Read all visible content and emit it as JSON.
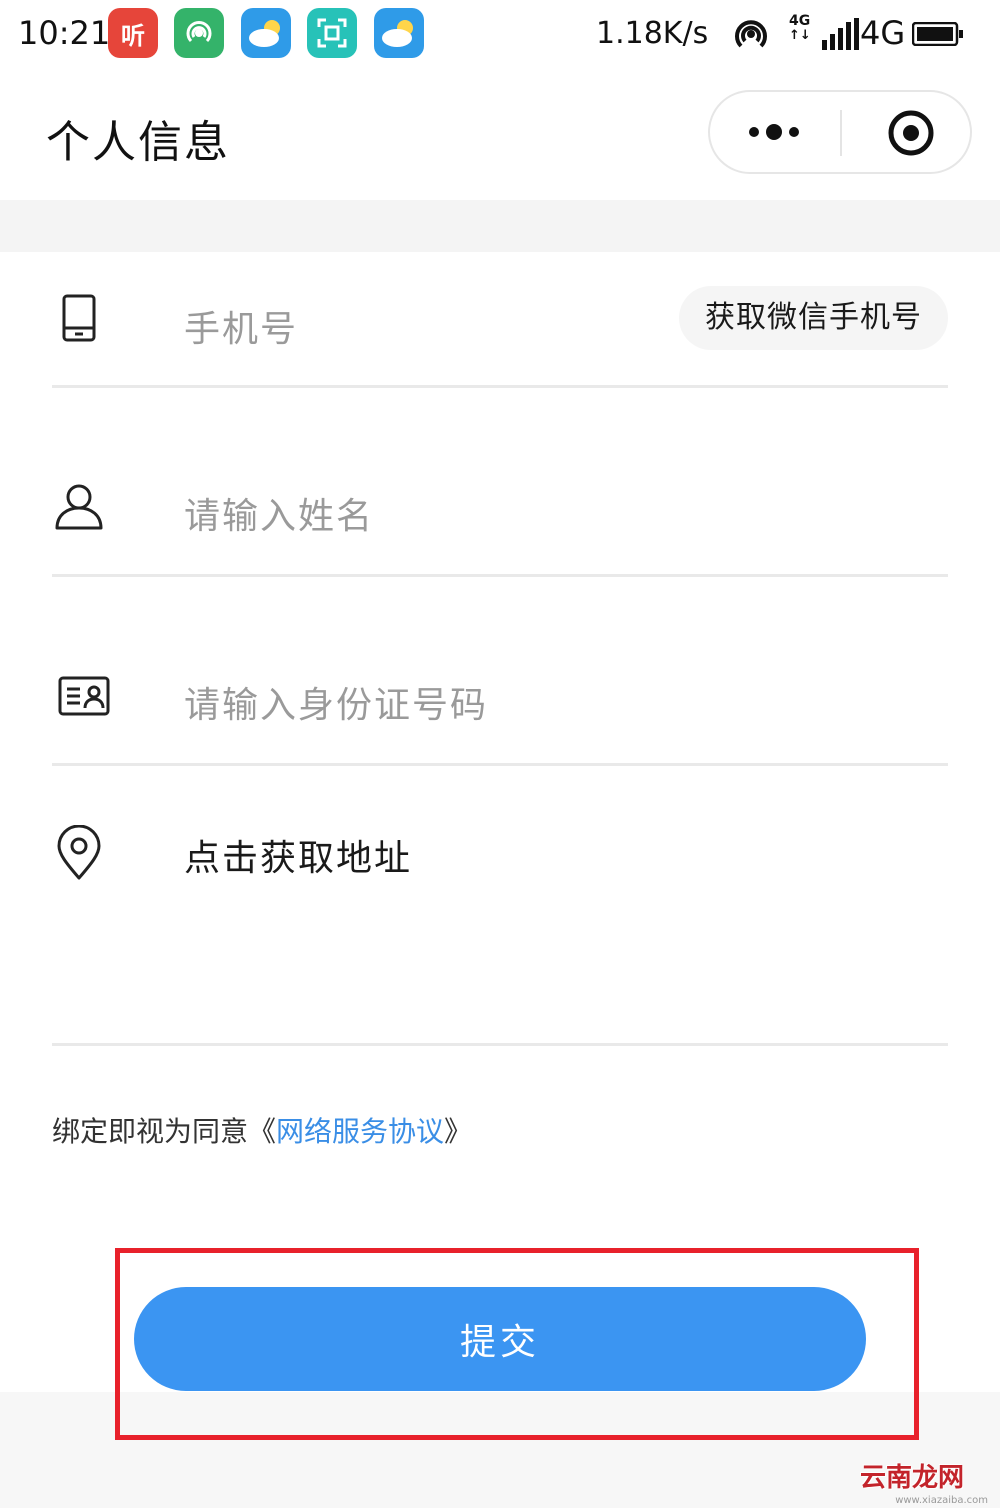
{
  "status_bar": {
    "time": "10:21",
    "app_icons": [
      {
        "name": "ting-app-icon",
        "text": "听",
        "color": "#e6453a"
      },
      {
        "name": "hotspot-app-icon",
        "text": "",
        "color": "#34b36a"
      },
      {
        "name": "weather-app-icon",
        "text": "",
        "color": "#2f9be8"
      },
      {
        "name": "scan-app-icon",
        "text": "",
        "color": "#27c2b8"
      },
      {
        "name": "weather-app-icon-2",
        "text": "",
        "color": "#2f9be8"
      }
    ],
    "net_speed": "1.18K/s",
    "mini_net_label": "4G",
    "network_label": "4G"
  },
  "nav": {
    "title": "个人信息"
  },
  "form": {
    "phone": {
      "placeholder": "手机号",
      "icon": "phone-icon"
    },
    "get_wechat_phone_label": "获取微信手机号",
    "name": {
      "placeholder": "请输入姓名",
      "icon": "person-icon"
    },
    "id_card": {
      "placeholder": "请输入身份证号码",
      "icon": "id-card-icon"
    },
    "address": {
      "label": "点击获取地址",
      "icon": "location-pin-icon"
    }
  },
  "agreement": {
    "prefix": "绑定即视为同意《",
    "link": "网络服务协议",
    "suffix": "》"
  },
  "submit_label": "提交",
  "colors": {
    "accent": "#3b95f2",
    "link": "#3a8ee6",
    "highlight": "#e8212b"
  },
  "watermark": {
    "main": "云南龙网",
    "url": "www.xiazaiba.com"
  }
}
